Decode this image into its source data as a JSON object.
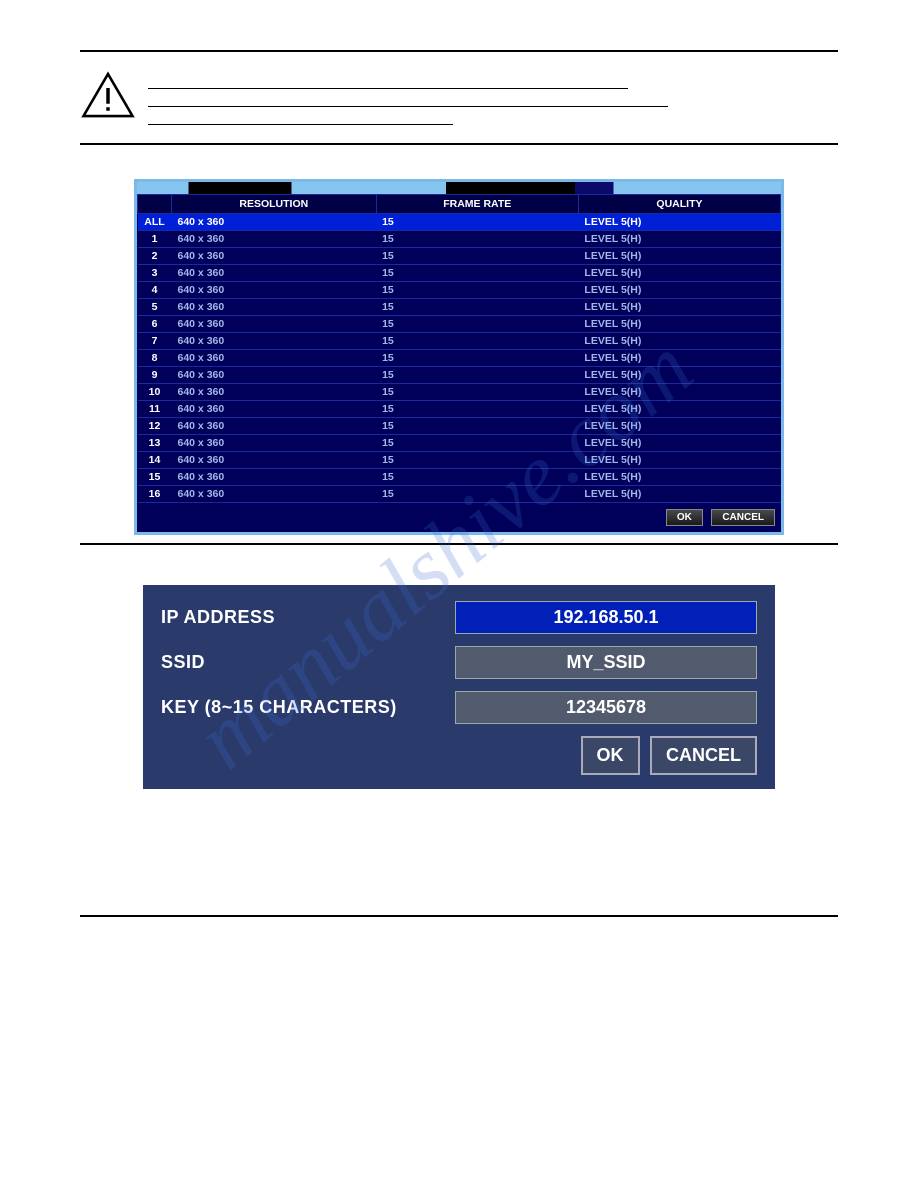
{
  "dvr_table": {
    "headers": {
      "resolution": "RESOLUTION",
      "frame_rate": "FRAME RATE",
      "quality": "QUALITY"
    },
    "rows": [
      {
        "id": "ALL",
        "resolution": "640 x 360",
        "frame_rate": "15",
        "quality": "LEVEL 5(H)",
        "selected": true
      },
      {
        "id": "1",
        "resolution": "640 x 360",
        "frame_rate": "15",
        "quality": "LEVEL 5(H)"
      },
      {
        "id": "2",
        "resolution": "640 x 360",
        "frame_rate": "15",
        "quality": "LEVEL 5(H)"
      },
      {
        "id": "3",
        "resolution": "640 x 360",
        "frame_rate": "15",
        "quality": "LEVEL 5(H)"
      },
      {
        "id": "4",
        "resolution": "640 x 360",
        "frame_rate": "15",
        "quality": "LEVEL 5(H)"
      },
      {
        "id": "5",
        "resolution": "640 x 360",
        "frame_rate": "15",
        "quality": "LEVEL 5(H)"
      },
      {
        "id": "6",
        "resolution": "640 x 360",
        "frame_rate": "15",
        "quality": "LEVEL 5(H)"
      },
      {
        "id": "7",
        "resolution": "640 x 360",
        "frame_rate": "15",
        "quality": "LEVEL 5(H)"
      },
      {
        "id": "8",
        "resolution": "640 x 360",
        "frame_rate": "15",
        "quality": "LEVEL 5(H)"
      },
      {
        "id": "9",
        "resolution": "640 x 360",
        "frame_rate": "15",
        "quality": "LEVEL 5(H)"
      },
      {
        "id": "10",
        "resolution": "640 x 360",
        "frame_rate": "15",
        "quality": "LEVEL 5(H)"
      },
      {
        "id": "11",
        "resolution": "640 x 360",
        "frame_rate": "15",
        "quality": "LEVEL 5(H)"
      },
      {
        "id": "12",
        "resolution": "640 x 360",
        "frame_rate": "15",
        "quality": "LEVEL 5(H)"
      },
      {
        "id": "13",
        "resolution": "640 x 360",
        "frame_rate": "15",
        "quality": "LEVEL 5(H)"
      },
      {
        "id": "14",
        "resolution": "640 x 360",
        "frame_rate": "15",
        "quality": "LEVEL 5(H)"
      },
      {
        "id": "15",
        "resolution": "640 x 360",
        "frame_rate": "15",
        "quality": "LEVEL 5(H)"
      },
      {
        "id": "16",
        "resolution": "640 x 360",
        "frame_rate": "15",
        "quality": "LEVEL 5(H)"
      }
    ],
    "ok_label": "OK",
    "cancel_label": "CANCEL"
  },
  "wifi_panel": {
    "ip_label": "IP ADDRESS",
    "ip_value": "192.168.50.1",
    "ssid_label": "SSID",
    "ssid_value": "MY_SSID",
    "key_label": "KEY (8~15 CHARACTERS)",
    "key_value": "12345678",
    "ok_label": "OK",
    "cancel_label": "CANCEL"
  }
}
